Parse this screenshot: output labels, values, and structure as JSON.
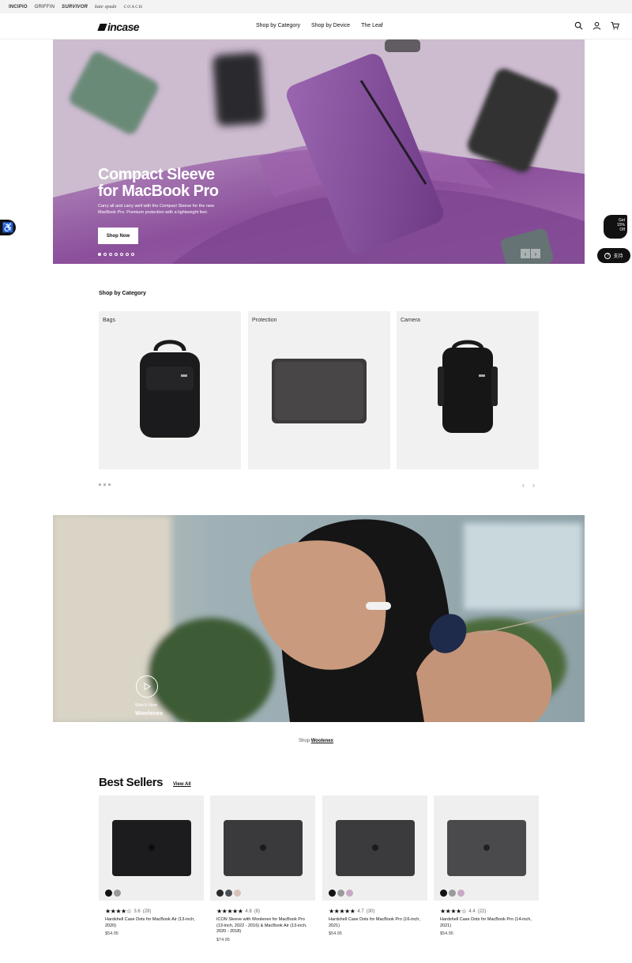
{
  "brands": [
    "INCIPIO",
    "GRIFFIN",
    "SURVIVOR",
    "kate spade",
    "COACH"
  ],
  "header": {
    "logo": "incase",
    "nav": [
      "Shop by Category",
      "Shop by Device",
      "The Leaf"
    ],
    "icons": [
      "search-icon",
      "account-icon",
      "cart-icon"
    ]
  },
  "hero": {
    "title_line1": "Compact Sleeve",
    "title_line2": "for MacBook Pro",
    "description": "Carry all and carry well with the Compact Sleeve for the new MacBook Pro. Premium protection with a lightweight feel.",
    "button": "Shop Now",
    "slides": 7,
    "active_slide": 1,
    "bg_color": "#c9b5cd"
  },
  "widgets": {
    "promo": [
      "Get",
      "15%",
      "Off"
    ],
    "support": "支持"
  },
  "categories": {
    "title": "Shop by Category",
    "items": [
      "Bags",
      "Protection",
      "Camera"
    ],
    "pages": 3
  },
  "video": {
    "watch_label": "Watch Now",
    "title": "Woolenex",
    "shop_prefix": "Shop",
    "shop_link": "Woolenex"
  },
  "best_sellers": {
    "title": "Best Sellers",
    "view_all": "View All",
    "products": [
      {
        "name": "Hardshell Case Dots for MacBook Air (13-inch, 2020)",
        "rating": "3.6",
        "reviews": "(29)",
        "stars": "★★★★☆",
        "price": "$54.95",
        "swatches": [
          "#111111",
          "#9a9a9a"
        ],
        "color": "#1c1c1e"
      },
      {
        "name": "ICON Sleeve with Woolenex for MacBook Pro (13-inch, 2022 - 2016) & MacBook Air (13-inch, 2020 - 2018)",
        "rating": "4.8",
        "reviews": "(8)",
        "stars": "★★★★★",
        "price": "$74.95",
        "swatches": [
          "#2a2a2a",
          "#4a4e55",
          "#d8c2b6"
        ],
        "color": "#3a3a3c"
      },
      {
        "name": "Hardshell Case Dots for MacBook Pro (16-inch, 2021)",
        "rating": "4.7",
        "reviews": "(30)",
        "stars": "★★★★★",
        "price": "$54.95",
        "swatches": [
          "#111111",
          "#9a9a9a",
          "#c8a8c4"
        ],
        "color": "#3b3b3d"
      },
      {
        "name": "Hardshell Case Dots for MacBook Pro (14-inch, 2021)",
        "rating": "4.4",
        "reviews": "(22)",
        "stars": "★★★★☆",
        "price": "$54.95",
        "swatches": [
          "#111111",
          "#9a9a9a",
          "#c8a8c4"
        ],
        "color": "#4a4a4c"
      }
    ]
  }
}
